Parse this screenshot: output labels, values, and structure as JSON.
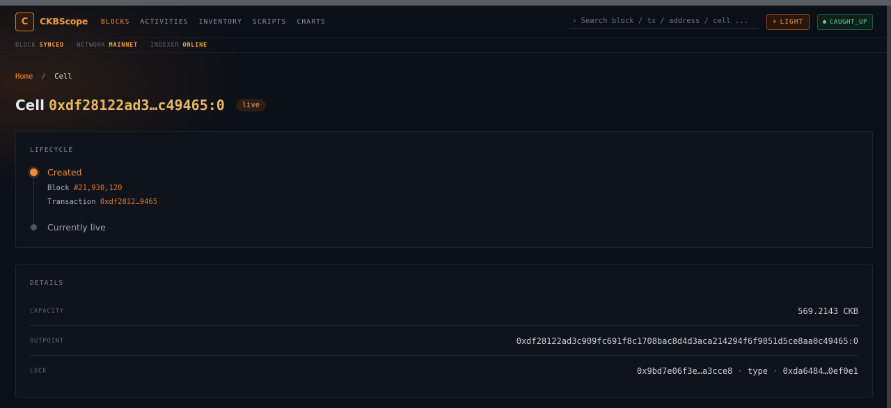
{
  "app": {
    "logo_letter": "C",
    "brand": "CKBScope"
  },
  "nav": {
    "items": [
      "BLOCKS",
      "ACTIVITIES",
      "INVENTORY",
      "SCRIPTS",
      "CHARTS"
    ],
    "active": "BLOCKS"
  },
  "search": {
    "placeholder": "› Search block / tx / address / cell ..."
  },
  "theme_button": {
    "icon": "sun-icon",
    "label": "LIGHT"
  },
  "sync_status": {
    "label": "CAUGHT_UP",
    "color": "#4fd69a"
  },
  "statusbar": {
    "block_label": "BLOCK",
    "block_value": "SYNCED",
    "network_label": "NETWORK",
    "network_value": "MAINNET",
    "indexer_label": "INDEXER",
    "indexer_value": "ONLINE"
  },
  "breadcrumb": {
    "home": "Home",
    "separator": "/",
    "current": "Cell"
  },
  "title": {
    "label": "Cell",
    "hash": "0xdf28122ad3…c49465:0",
    "status_badge": "live"
  },
  "lifecycle": {
    "heading": "LIFECYCLE",
    "created_label": "Created",
    "block_label": "Block",
    "block_number": "#21,930,120",
    "tx_label": "Transaction",
    "tx_hash": "0xdf2812…9465",
    "current_label": "Currently live"
  },
  "details": {
    "heading": "DETAILS",
    "capacity_label": "CAPACITY",
    "capacity_value": "569.2143 CKB",
    "outpoint_label": "OUTPOINT",
    "outpoint_value": "0xdf28122ad3c909fc691f8c1708bac8d4d3aca214294f6f9051d5ce8aa0c49465:0",
    "lock_label": "LOCK",
    "lock_hash": "0x9bd7e06f3e…a3cce8",
    "lock_sep": "·",
    "lock_type_label": "type",
    "lock_type_hash": "0xda6484…0ef0e1"
  },
  "colors": {
    "accent": "#f08a36",
    "background": "#0b0f17",
    "card": "#0e131c",
    "gold": "#e8b864"
  }
}
